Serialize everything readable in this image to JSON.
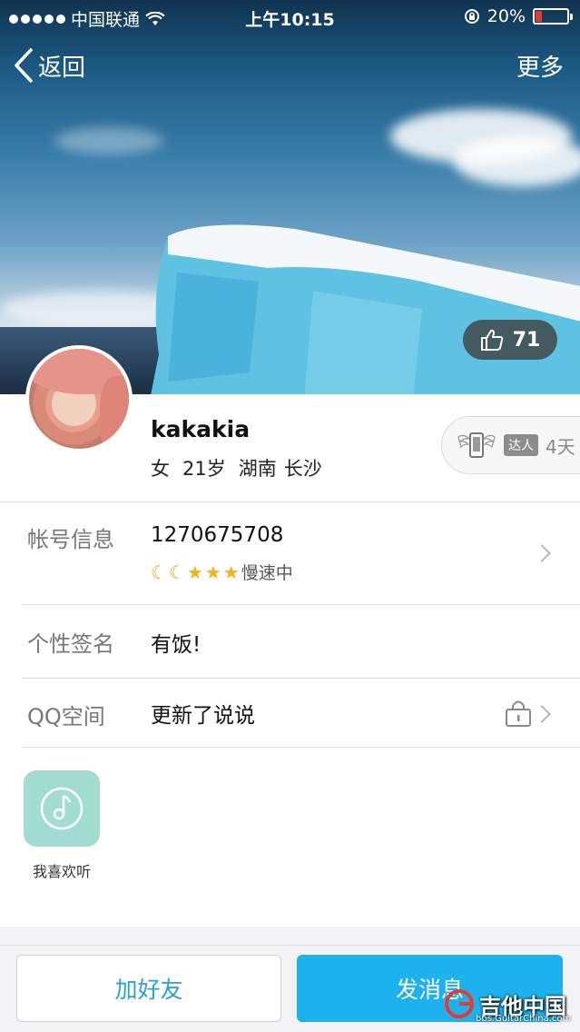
{
  "status_bar": {
    "carrier": "中国联通",
    "time": "上午10:15",
    "battery": "20%",
    "battery_level": 0.2
  },
  "nav": {
    "back_label": "返回",
    "more_label": "更多"
  },
  "cover": {
    "like_count": "71"
  },
  "profile": {
    "username": "kakakia",
    "gender": "女",
    "age": "21岁",
    "province": "湖南",
    "city": "长沙",
    "expert_badge": "达人",
    "expert_days": "4天"
  },
  "rows": {
    "account_label": "帐号信息",
    "account_value": "1270675708",
    "level_status": "慢速中",
    "signature_label": "个性签名",
    "signature_value": "有饭!",
    "qzone_label": "QQ空间",
    "qzone_value": "更新了说说"
  },
  "apps": {
    "music_label": "我喜欢听"
  },
  "actions": {
    "add_friend": "加好友",
    "send_message": "发消息"
  },
  "watermark": {
    "text": "吉他中国",
    "sub": "bbs.GuitarChina.com"
  },
  "colors": {
    "accent_blue": "#1db2ee",
    "link_blue": "#28a0e0",
    "battery_red": "#e53935",
    "tile_green": "#a3ddd2"
  }
}
